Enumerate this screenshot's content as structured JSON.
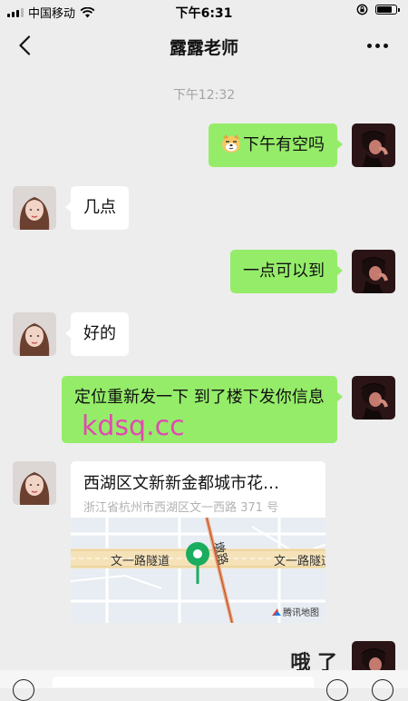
{
  "status_bar": {
    "carrier": "中国移动",
    "time": "下午6:31",
    "battery_level": 0.85,
    "icons": [
      "signal-icon",
      "wifi-icon",
      "orientation-lock-icon",
      "battery-icon"
    ]
  },
  "nav": {
    "title": "露露老师",
    "back_icon": "chevron-left-icon",
    "more_icon": "more-icon"
  },
  "chat": {
    "timestamp": "下午12:32",
    "messages": [
      {
        "side": "sent",
        "emoji": "dog-emoji",
        "text": "下午有空吗"
      },
      {
        "side": "received",
        "text": "几点"
      },
      {
        "side": "sent",
        "text": "一点可以到"
      },
      {
        "side": "received",
        "text": "好的"
      },
      {
        "side": "sent",
        "text": "定位重新发一下 到了楼下发你信息"
      },
      {
        "side": "received",
        "type": "location",
        "title": "西湖区文新新金都城市花…",
        "address": "浙江省杭州市西湖区文一西路 371 号",
        "map_labels": {
          "road_left": "文一路隧道",
          "road_right": "文一路隧道",
          "vertical_road": "墩路",
          "credit": "腾讯地图"
        }
      },
      {
        "side": "sent",
        "text": "哦 了"
      }
    ]
  },
  "watermark": "kdsq.cc"
}
